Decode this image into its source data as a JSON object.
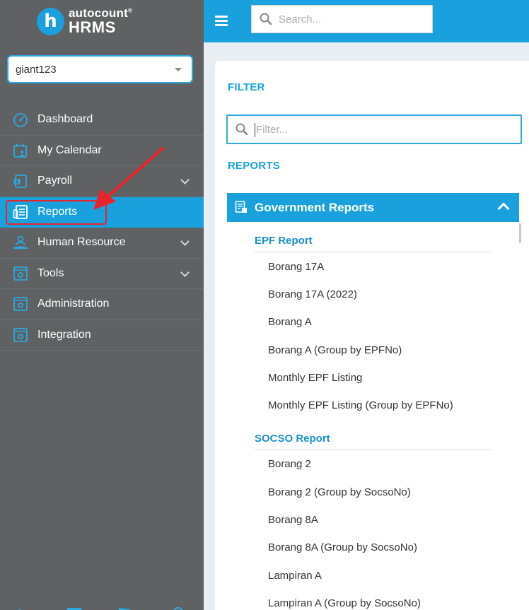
{
  "app": {
    "logo_badge": "h",
    "logo_line1": "autocount",
    "logo_line2": "HRMS"
  },
  "company": {
    "selected": "giant123"
  },
  "sidebar": {
    "items": [
      {
        "label": "Dashboard",
        "icon": "dashboard-icon"
      },
      {
        "label": "My Calendar",
        "icon": "calendar-icon"
      },
      {
        "label": "Payroll",
        "icon": "payroll-icon"
      },
      {
        "label": "Reports",
        "icon": "reports-icon"
      },
      {
        "label": "Human Resource",
        "icon": "human-resource-icon"
      },
      {
        "label": "Tools",
        "icon": "tools-icon"
      },
      {
        "label": "Administration",
        "icon": "administration-icon"
      },
      {
        "label": "Integration",
        "icon": "integration-icon"
      }
    ]
  },
  "topbar": {
    "search_placeholder": "Search..."
  },
  "main": {
    "filter_title": "FILTER",
    "filter_placeholder": "Filter...",
    "reports_title": "REPORTS",
    "group_title": "Government Reports",
    "sections": [
      {
        "title": "EPF Report",
        "items": [
          "Borang 17A",
          "Borang 17A (2022)",
          "Borang A",
          "Borang A (Group by EPFNo)",
          "Monthly EPF Listing",
          "Monthly EPF Listing (Group by EPFNo)"
        ]
      },
      {
        "title": "SOCSO Report",
        "items": [
          "Borang 2",
          "Borang 2 (Group by SocsoNo)",
          "Borang 8A",
          "Borang 8A (Group by SocsoNo)",
          "Lampiran A",
          "Lampiran A (Group by SocsoNo)"
        ]
      }
    ]
  },
  "colors": {
    "accent": "#1aa1dd",
    "sidebar_bg": "#5f6163",
    "annotation": "#e8242a"
  }
}
